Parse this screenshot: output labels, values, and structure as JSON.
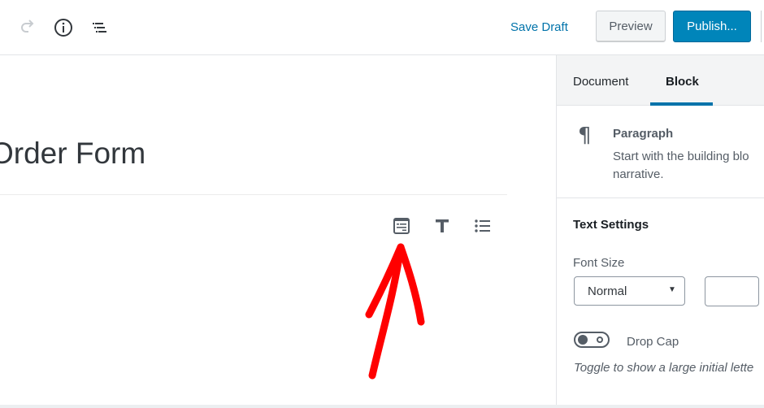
{
  "header": {
    "icons": [
      "redo-icon",
      "info-icon",
      "outline-icon"
    ],
    "save_draft": "Save Draft",
    "preview": "Preview",
    "publish": "Publish..."
  },
  "editor": {
    "post_title": "Order Form",
    "block_toolbar": [
      "form-block-icon",
      "heading-icon",
      "list-icon"
    ],
    "annotation": "red-arrow pointing to form block icon"
  },
  "sidebar": {
    "tabs": [
      {
        "label": "Document",
        "active": false
      },
      {
        "label": "Block",
        "active": true
      }
    ],
    "block": {
      "icon": "paragraph-icon",
      "name": "Paragraph",
      "description_line1": "Start with the building blo",
      "description_line2": "narrative."
    },
    "text_settings": {
      "title": "Text Settings",
      "font_size_label": "Font Size",
      "font_size_value": "Normal",
      "custom_size_value": "",
      "drop_cap_label": "Drop Cap",
      "drop_cap_enabled": false,
      "drop_cap_help": "Toggle to show a large initial lette"
    }
  },
  "colors": {
    "accent": "#0073aa",
    "publish_bg": "#0085ba",
    "arrow": "#ff0000"
  }
}
